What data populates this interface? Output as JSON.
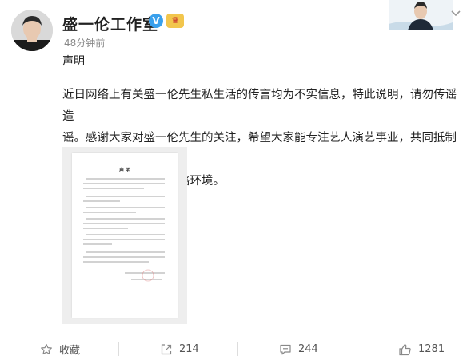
{
  "post": {
    "author": "盛一伦工作室",
    "vip_badge": "♛",
    "time": "48分钟前",
    "title": "声明",
    "content_lines": [
      "近日网络上有关盛一伦先生私生活的传言均为不实信息，特此说明，请勿传谣造",
      "谣。感谢大家对盛一伦先生的关注，希望大家能专注艺人演艺事业，共同抵制网",
      "络谣言，维护和谐的网络环境。"
    ],
    "document_image": {
      "heading": "声 明"
    }
  },
  "actions": {
    "favorite": {
      "label": "收藏",
      "icon": "star-icon"
    },
    "repost": {
      "count": "214",
      "icon": "repost-icon"
    },
    "comment": {
      "count": "244",
      "icon": "comment-icon"
    },
    "like": {
      "count": "1281",
      "icon": "thumbs-up-icon"
    }
  },
  "colors": {
    "verified": "#3aa0ec",
    "vip": "#f2c64d",
    "icon_gray": "#888888"
  }
}
